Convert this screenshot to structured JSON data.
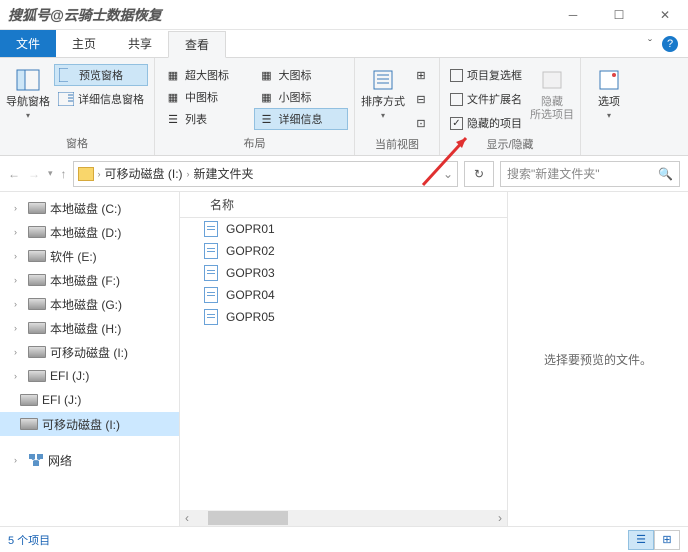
{
  "title_watermark": "搜狐号@云骑士数据恢复",
  "tabs": {
    "file": "文件",
    "home": "主页",
    "share": "共享",
    "view": "查看"
  },
  "ribbon": {
    "panes": {
      "nav": "导航窗格",
      "preview": "预览窗格",
      "details": "详细信息窗格",
      "label": "窗格"
    },
    "layout": {
      "extra_large": "超大图标",
      "large": "大图标",
      "medium": "中图标",
      "small": "小图标",
      "list": "列表",
      "detail": "详细信息",
      "label": "布局"
    },
    "current": {
      "sort": "排序方式",
      "label": "当前视图"
    },
    "showhide": {
      "checkboxes": "项目复选框",
      "extensions": "文件扩展名",
      "hidden": "隐藏的项目",
      "hide_selected": "隐藏\n所选项目",
      "label": "显示/隐藏"
    },
    "options": "选项"
  },
  "breadcrumb": {
    "drive": "可移动磁盘 (I:)",
    "folder": "新建文件夹"
  },
  "search_placeholder": "搜索\"新建文件夹\"",
  "tree": [
    {
      "label": "本地磁盘 (C:)",
      "exp": true
    },
    {
      "label": "本地磁盘 (D:)",
      "exp": true
    },
    {
      "label": "软件 (E:)",
      "exp": true
    },
    {
      "label": "本地磁盘 (F:)",
      "exp": true
    },
    {
      "label": "本地磁盘 (G:)",
      "exp": true
    },
    {
      "label": "本地磁盘 (H:)",
      "exp": true
    },
    {
      "label": "可移动磁盘 (I:)",
      "exp": true
    },
    {
      "label": "EFI (J:)",
      "exp": true
    },
    {
      "label": "EFI (J:)",
      "exp": false,
      "indent": true
    },
    {
      "label": "可移动磁盘 (I:)",
      "exp": false,
      "indent": true,
      "selected": true
    }
  ],
  "network_label": "网络",
  "column_name": "名称",
  "files": [
    "GOPR01",
    "GOPR02",
    "GOPR03",
    "GOPR04",
    "GOPR05"
  ],
  "preview_empty": "选择要预览的文件。",
  "status": "5 个项目"
}
